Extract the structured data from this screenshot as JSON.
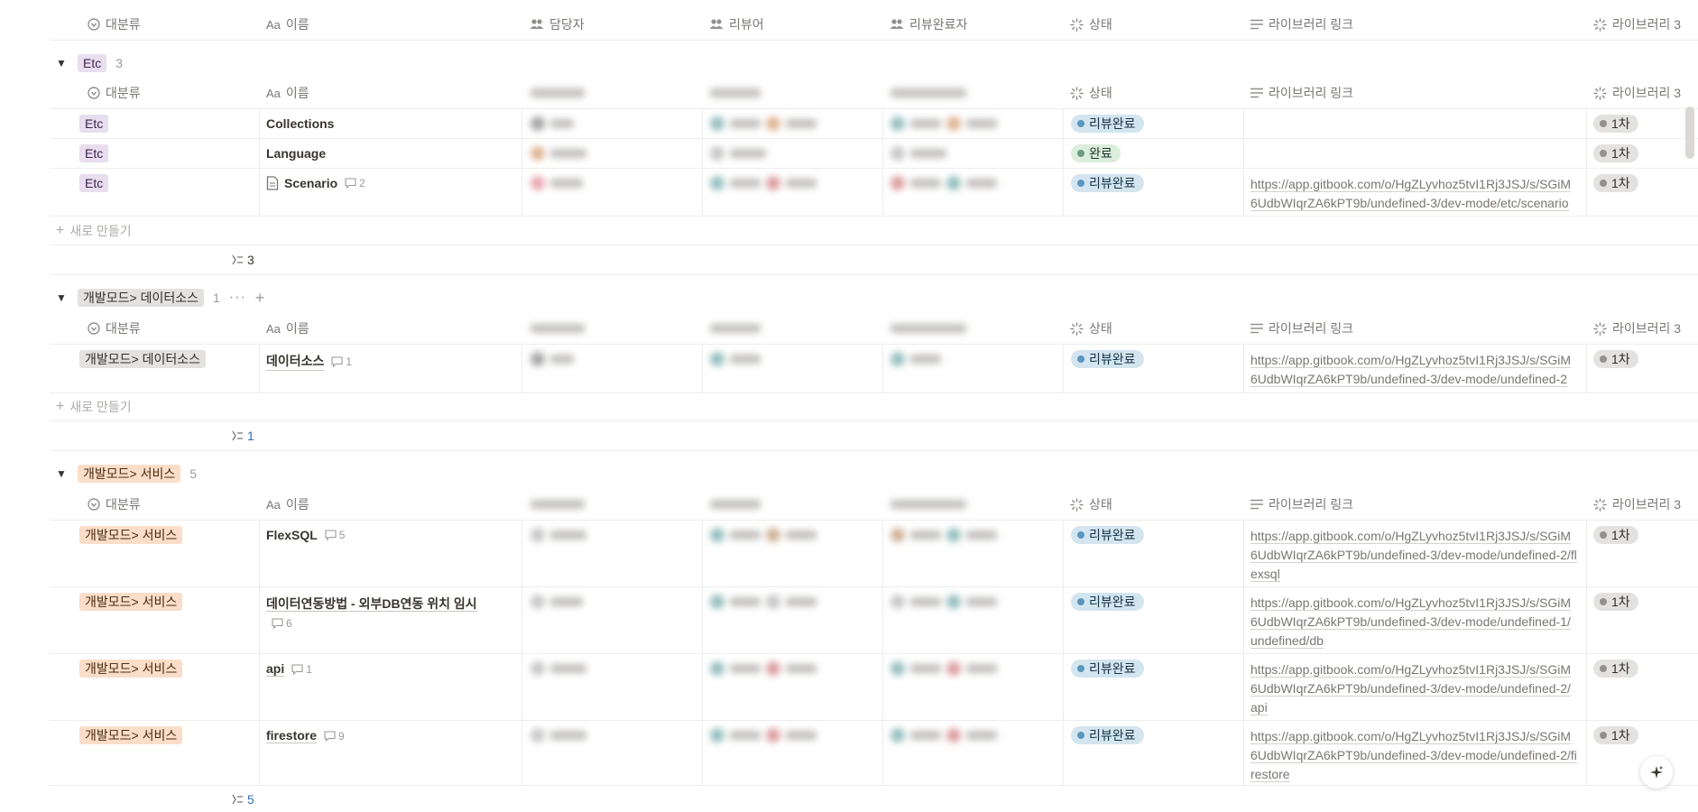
{
  "columns": {
    "category": "대분류",
    "name": "이름",
    "name_prefix": "Aa",
    "assignee": "담당자",
    "reviewer": "리뷰어",
    "review_done": "리뷰완료자",
    "status": "상태",
    "library_link": "라이브러리 링크",
    "library_round": "라이브러리 3"
  },
  "new_label": "새로 만들기",
  "groups": [
    {
      "title": "Etc",
      "count": "3",
      "rows": [
        {
          "category": "Etc",
          "name": "Collections",
          "comments": "",
          "status": "리뷰완료",
          "link": "",
          "round": "1차"
        },
        {
          "category": "Etc",
          "name": "Language",
          "comments": "",
          "status": "완료",
          "link": "",
          "round": "1차"
        },
        {
          "category": "Etc",
          "name": "Scenario",
          "comments": "2",
          "status": "리뷰완료",
          "link": "https://app.gitbook.com/o/HgZLyvhoz5tvI1Rj3JSJ/s/SGiM6UdbWIqrZA6kPT9b/undefined-3/dev-mode/etc/scenario",
          "round": "1차"
        }
      ],
      "summary": "3"
    },
    {
      "title": "개발모드> 데이터소스",
      "count": "1",
      "rows": [
        {
          "category": "개발모드> 데이터소스",
          "name": "데이터소스",
          "comments": "1",
          "status": "리뷰완료",
          "link": "https://app.gitbook.com/o/HgZLyvhoz5tvI1Rj3JSJ/s/SGiM6UdbWIqrZA6kPT9b/undefined-3/dev-mode/undefined-2",
          "round": "1차"
        }
      ],
      "summary": "1"
    },
    {
      "title": "개발모드> 서비스",
      "count": "5",
      "rows": [
        {
          "category": "개발모드> 서비스",
          "name": "FlexSQL",
          "comments": "5",
          "status": "리뷰완료",
          "link": "https://app.gitbook.com/o/HgZLyvhoz5tvI1Rj3JSJ/s/SGiM6UdbWIqrZA6kPT9b/undefined-3/dev-mode/undefined-2/flexsql",
          "round": "1차"
        },
        {
          "category": "개발모드> 서비스",
          "name": "데이터연동방법 - 외부DB연동 위치 임시",
          "comments": "6",
          "status": "리뷰완료",
          "link": "https://app.gitbook.com/o/HgZLyvhoz5tvI1Rj3JSJ/s/SGiM6UdbWIqrZA6kPT9b/undefined-3/dev-mode/undefined-1/undefined/db",
          "round": "1차"
        },
        {
          "category": "개발모드> 서비스",
          "name": "api",
          "comments": "1",
          "status": "리뷰완료",
          "link": "https://app.gitbook.com/o/HgZLyvhoz5tvI1Rj3JSJ/s/SGiM6UdbWIqrZA6kPT9b/undefined-3/dev-mode/undefined-2/api",
          "round": "1차"
        },
        {
          "category": "개발모드> 서비스",
          "name": "firestore",
          "comments": "9",
          "status": "리뷰완료",
          "link": "https://app.gitbook.com/o/HgZLyvhoz5tvI1Rj3JSJ/s/SGiM6UdbWIqrZA6kPT9b/undefined-3/dev-mode/undefined-2/firestore",
          "round": "1차"
        }
      ],
      "summary": "5"
    }
  ]
}
